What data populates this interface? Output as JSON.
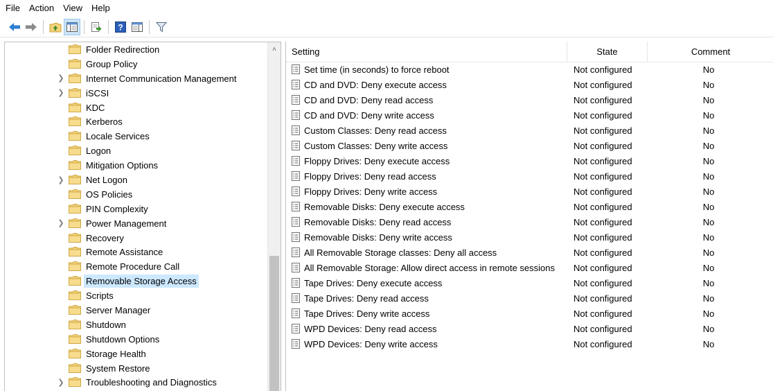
{
  "menu": [
    "File",
    "Action",
    "View",
    "Help"
  ],
  "toolbar": {
    "buttons": [
      {
        "name": "back-arrow-icon"
      },
      {
        "name": "forward-arrow-icon"
      },
      {
        "name": "up-folder-icon"
      },
      {
        "name": "show-hide-tree-icon"
      },
      {
        "name": "export-list-icon"
      },
      {
        "name": "help-icon"
      },
      {
        "name": "properties-view-icon"
      },
      {
        "name": "filter-icon"
      }
    ]
  },
  "tree": {
    "items": [
      {
        "label": "Folder Redirection",
        "expandable": false,
        "selected": false
      },
      {
        "label": "Group Policy",
        "expandable": false,
        "selected": false
      },
      {
        "label": "Internet Communication Management",
        "expandable": true,
        "selected": false
      },
      {
        "label": "iSCSI",
        "expandable": true,
        "selected": false
      },
      {
        "label": "KDC",
        "expandable": false,
        "selected": false
      },
      {
        "label": "Kerberos",
        "expandable": false,
        "selected": false
      },
      {
        "label": "Locale Services",
        "expandable": false,
        "selected": false
      },
      {
        "label": "Logon",
        "expandable": false,
        "selected": false
      },
      {
        "label": "Mitigation Options",
        "expandable": false,
        "selected": false
      },
      {
        "label": "Net Logon",
        "expandable": true,
        "selected": false
      },
      {
        "label": "OS Policies",
        "expandable": false,
        "selected": false
      },
      {
        "label": "PIN Complexity",
        "expandable": false,
        "selected": false
      },
      {
        "label": "Power Management",
        "expandable": true,
        "selected": false
      },
      {
        "label": "Recovery",
        "expandable": false,
        "selected": false
      },
      {
        "label": "Remote Assistance",
        "expandable": false,
        "selected": false
      },
      {
        "label": "Remote Procedure Call",
        "expandable": false,
        "selected": false
      },
      {
        "label": "Removable Storage Access",
        "expandable": false,
        "selected": true
      },
      {
        "label": "Scripts",
        "expandable": false,
        "selected": false
      },
      {
        "label": "Server Manager",
        "expandable": false,
        "selected": false
      },
      {
        "label": "Shutdown",
        "expandable": false,
        "selected": false
      },
      {
        "label": "Shutdown Options",
        "expandable": false,
        "selected": false
      },
      {
        "label": "Storage Health",
        "expandable": false,
        "selected": false
      },
      {
        "label": "System Restore",
        "expandable": false,
        "selected": false
      },
      {
        "label": "Troubleshooting and Diagnostics",
        "expandable": true,
        "selected": false
      }
    ]
  },
  "list": {
    "columns": {
      "setting": "Setting",
      "state": "State",
      "comment": "Comment"
    },
    "rows": [
      {
        "setting": "Set time (in seconds) to force reboot",
        "state": "Not configured",
        "comment": "No"
      },
      {
        "setting": "CD and DVD: Deny execute access",
        "state": "Not configured",
        "comment": "No"
      },
      {
        "setting": "CD and DVD: Deny read access",
        "state": "Not configured",
        "comment": "No"
      },
      {
        "setting": "CD and DVD: Deny write access",
        "state": "Not configured",
        "comment": "No"
      },
      {
        "setting": "Custom Classes: Deny read access",
        "state": "Not configured",
        "comment": "No"
      },
      {
        "setting": "Custom Classes: Deny write access",
        "state": "Not configured",
        "comment": "No"
      },
      {
        "setting": "Floppy Drives: Deny execute access",
        "state": "Not configured",
        "comment": "No"
      },
      {
        "setting": "Floppy Drives: Deny read access",
        "state": "Not configured",
        "comment": "No"
      },
      {
        "setting": "Floppy Drives: Deny write access",
        "state": "Not configured",
        "comment": "No"
      },
      {
        "setting": "Removable Disks: Deny execute access",
        "state": "Not configured",
        "comment": "No"
      },
      {
        "setting": "Removable Disks: Deny read access",
        "state": "Not configured",
        "comment": "No"
      },
      {
        "setting": "Removable Disks: Deny write access",
        "state": "Not configured",
        "comment": "No"
      },
      {
        "setting": "All Removable Storage classes: Deny all access",
        "state": "Not configured",
        "comment": "No"
      },
      {
        "setting": "All Removable Storage: Allow direct access in remote sessions",
        "state": "Not configured",
        "comment": "No"
      },
      {
        "setting": "Tape Drives: Deny execute access",
        "state": "Not configured",
        "comment": "No"
      },
      {
        "setting": "Tape Drives: Deny read access",
        "state": "Not configured",
        "comment": "No"
      },
      {
        "setting": "Tape Drives: Deny write access",
        "state": "Not configured",
        "comment": "No"
      },
      {
        "setting": "WPD Devices: Deny read access",
        "state": "Not configured",
        "comment": "No"
      },
      {
        "setting": "WPD Devices: Deny write access",
        "state": "Not configured",
        "comment": "No"
      }
    ]
  },
  "colors": {
    "selection": "#cce8ff",
    "folder": "#f3d27a",
    "accent": "#2d7fd2"
  }
}
